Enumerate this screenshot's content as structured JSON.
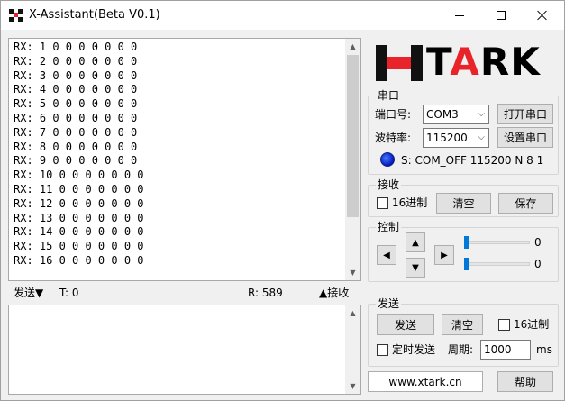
{
  "window": {
    "title": "X-Assistant(Beta V0.1)",
    "icon": "app-logo-icon"
  },
  "receive": {
    "lines": [
      "RX: 1 0 0 0 0 0 0 0",
      "RX: 2 0 0 0 0 0 0 0",
      "RX: 3 0 0 0 0 0 0 0",
      "RX: 4 0 0 0 0 0 0 0",
      "RX: 5 0 0 0 0 0 0 0",
      "RX: 6 0 0 0 0 0 0 0",
      "RX: 7 0 0 0 0 0 0 0",
      "RX: 8 0 0 0 0 0 0 0",
      "RX: 9 0 0 0 0 0 0 0",
      "RX: 10 0 0 0 0 0 0 0",
      "RX: 11 0 0 0 0 0 0 0",
      "RX: 12 0 0 0 0 0 0 0",
      "RX: 13 0 0 0 0 0 0 0",
      "RX: 14 0 0 0 0 0 0 0",
      "RX: 15 0 0 0 0 0 0 0",
      "RX: 16 0 0 0 0 0 0 0"
    ]
  },
  "status": {
    "send_toggle": "发送▼",
    "tx_count": "T: 0",
    "rx_count": "R:  589",
    "recv_toggle": "▲接收"
  },
  "logo": {
    "text_first": "T",
    "text_accent": "A",
    "text_rest": "RK",
    "accent_color": "#e8232a"
  },
  "serial": {
    "title": "串口",
    "port_label": "端口号:",
    "port_value": "COM3",
    "open_button": "打开串口",
    "baud_label": "波特率:",
    "baud_value": "115200",
    "settings_button": "设置串口",
    "state_prefix": "S:",
    "state_text": "COM_OFF 115200 N 8 1"
  },
  "receive_group": {
    "title": "接收",
    "hex_label": "16进制",
    "clear_button": "清空",
    "save_button": "保存"
  },
  "control": {
    "title": "控制",
    "slider1_value": "0",
    "slider2_value": "0"
  },
  "send_group": {
    "title": "发送",
    "send_button": "发送",
    "clear_button": "清空",
    "hex_label": "16进制",
    "timed_label": "定时发送",
    "period_label": "周期:",
    "period_value": "1000",
    "period_unit": "ms"
  },
  "footer": {
    "url": "www.xtark.cn",
    "help_button": "帮助"
  }
}
